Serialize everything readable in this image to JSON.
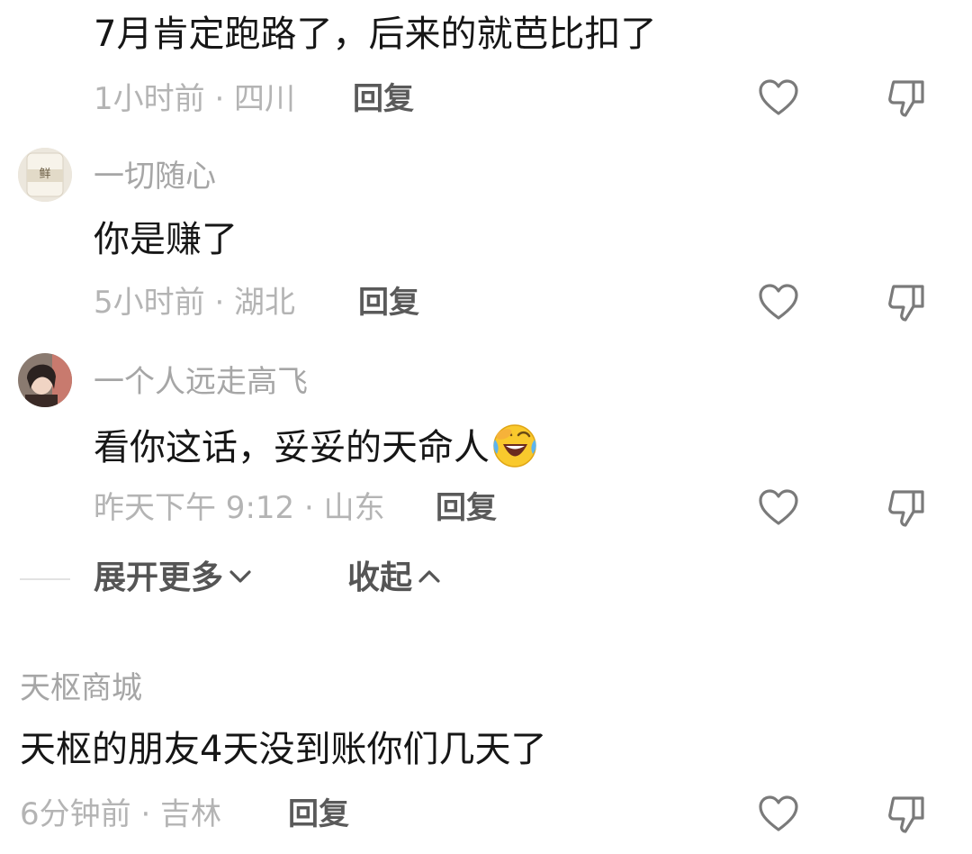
{
  "comments": [
    {
      "text": "7月肯定跑路了，后来的就芭比扣了",
      "meta": "1小时前 · 四川",
      "reply": "回复"
    },
    {
      "user": "一切随心",
      "avatar_icon": "avatar-cup-icon",
      "avatar_caption": "鲜",
      "text": "你是赚了",
      "meta": "5小时前 · 湖北",
      "reply": "回复"
    },
    {
      "user": "一个人远走高飞",
      "avatar_icon": "avatar-photo-icon",
      "text": "看你这话，妥妥的天命人",
      "emoji": "laughing-crying-emoji",
      "meta": "昨天下午 9:12 · 山东",
      "reply": "回复"
    }
  ],
  "thread_controls": {
    "expand_more": "展开更多",
    "collapse": "收起"
  },
  "bottom_comment": {
    "user": "天枢商城",
    "text": "天枢的朋友4天没到账你们几天了",
    "meta": "6分钟前 · 吉林",
    "reply": "回复"
  },
  "icons": {
    "like": "heart-outline-icon",
    "dislike": "thumbs-down-outline-icon"
  },
  "colors": {
    "text": "#161616",
    "meta": "#b4b4b4",
    "reply": "#5a5a5a",
    "icon": "#7a7a7a"
  }
}
